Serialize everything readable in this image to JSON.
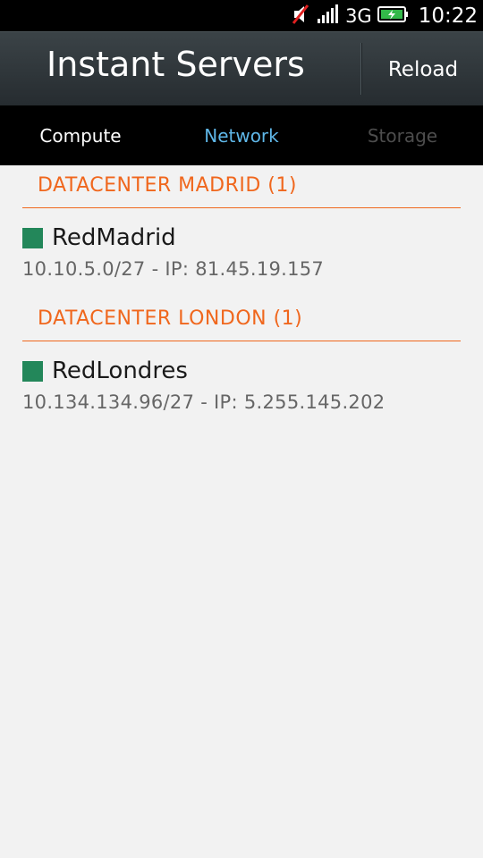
{
  "status_bar": {
    "network": "3G",
    "time": "10:22",
    "icons": [
      "muted-speaker-icon",
      "signal-icon",
      "battery-charging-icon"
    ]
  },
  "header": {
    "title": "Instant Servers",
    "reload_label": "Reload"
  },
  "tabs": [
    {
      "label": "Compute",
      "state": "normal"
    },
    {
      "label": "Network",
      "state": "selected"
    },
    {
      "label": "Storage",
      "state": "disabled"
    }
  ],
  "sections": [
    {
      "title": "DATACENTER MADRID (1)",
      "items": [
        {
          "name": "RedMadrid",
          "detail": "10.10.5.0/27 - IP: 81.45.19.157",
          "status_color": "#23875a"
        }
      ]
    },
    {
      "title": "DATACENTER LONDON (1)",
      "items": [
        {
          "name": "RedLondres",
          "detail": "10.134.134.96/27 - IP: 5.255.145.202",
          "status_color": "#23875a"
        }
      ]
    }
  ],
  "colors": {
    "accent": "#f0671d",
    "selected_tab": "#5fb7e8",
    "status_ok": "#23875a"
  }
}
